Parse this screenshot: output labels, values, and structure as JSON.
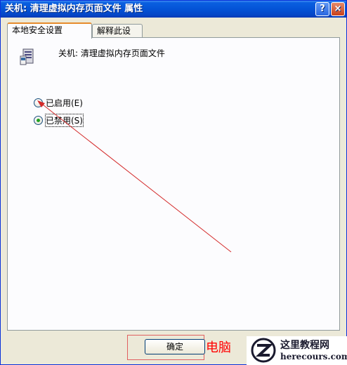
{
  "window": {
    "title": "关机: 清理虚拟内存页面文件 属性",
    "help_label": "?",
    "close_label": "×"
  },
  "tabs": [
    {
      "label": "本地安全设置",
      "active": true
    },
    {
      "label": "解释此设置",
      "active": false
    }
  ],
  "policy": {
    "icon": "policy-computer-icon",
    "title": "关机: 清理虚拟内存页面文件"
  },
  "options": [
    {
      "label": "已启用(E)",
      "checked": false
    },
    {
      "label": "已禁用(S)",
      "checked": true
    }
  ],
  "footer": {
    "ok_label": "确定",
    "annotation": "电脑"
  },
  "watermark": {
    "cn": "这里教程网",
    "en": "herecours.com"
  },
  "colors": {
    "title_bar": "#0453d6",
    "annotation": "#ff0000",
    "radio_selected": "#21a121"
  }
}
